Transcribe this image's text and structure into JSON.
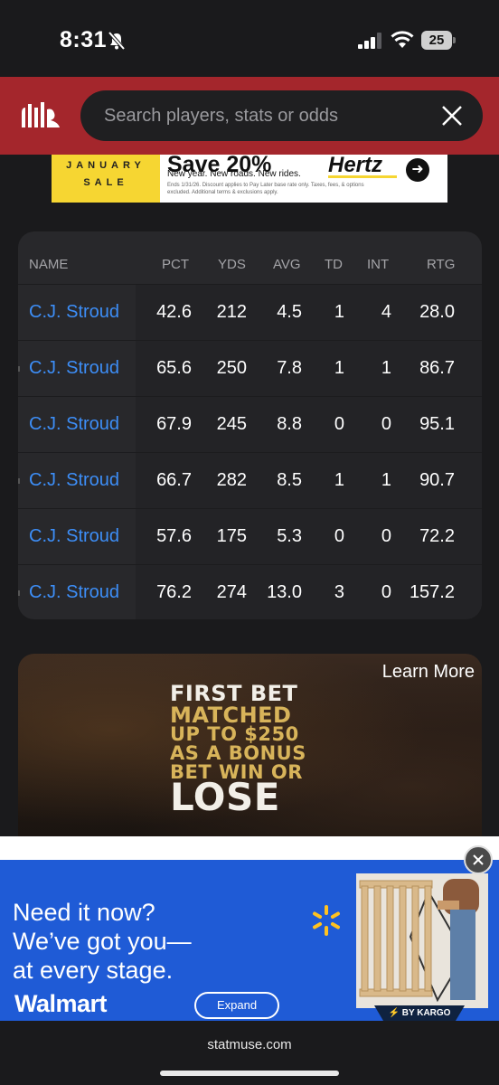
{
  "status_bar": {
    "time": "8:31",
    "battery": "25"
  },
  "header": {
    "search_placeholder": "Search players, stats or odds"
  },
  "top_ad": {
    "month_line1": "JANUARY",
    "month_line2": "SALE",
    "headline": "Save 20%",
    "tagline": "New year. New roads. New rides.",
    "fine_print": "Ends 1/31/26. Discount applies to Pay Later base rate only. Taxes, fees, & options excluded. Additional terms & exclusions apply.",
    "brand": "Hertz"
  },
  "stats_table": {
    "columns": [
      "NAME",
      "PCT",
      "YDS",
      "AVG",
      "TD",
      "INT",
      "RTG"
    ],
    "rows": [
      {
        "name": "C.J. Stroud",
        "pct": "42.6",
        "yds": "212",
        "avg": "4.5",
        "td": "1",
        "int": "4",
        "rtg": "28.0"
      },
      {
        "name": "C.J. Stroud",
        "pct": "65.6",
        "yds": "250",
        "avg": "7.8",
        "td": "1",
        "int": "1",
        "rtg": "86.7"
      },
      {
        "name": "C.J. Stroud",
        "pct": "67.9",
        "yds": "245",
        "avg": "8.8",
        "td": "0",
        "int": "0",
        "rtg": "95.1"
      },
      {
        "name": "C.J. Stroud",
        "pct": "66.7",
        "yds": "282",
        "avg": "8.5",
        "td": "1",
        "int": "1",
        "rtg": "90.7"
      },
      {
        "name": "C.J. Stroud",
        "pct": "57.6",
        "yds": "175",
        "avg": "5.3",
        "td": "0",
        "int": "0",
        "rtg": "72.2"
      },
      {
        "name": "C.J. Stroud",
        "pct": "76.2",
        "yds": "274",
        "avg": "13.0",
        "td": "3",
        "int": "0",
        "rtg": "157.2"
      }
    ]
  },
  "promo": {
    "learn_more": "Learn More",
    "lines": [
      "FIRST BET",
      "MATCHED",
      "UP TO $250",
      "AS A BONUS",
      "BET WIN OR",
      "LOSE"
    ]
  },
  "walmart_ad": {
    "headline_1": "Need it now?",
    "headline_2": "We’ve got you—",
    "headline_3": "at every stage.",
    "brand": "Walmart",
    "expand_label": "Expand",
    "kargo_label": "⚡ BY KARGO"
  },
  "footer": {
    "url": "statmuse.com"
  },
  "colors": {
    "header_red": "#a4262c",
    "link_blue": "#3d8ef7",
    "walmart_blue": "#1f5bd6",
    "walmart_yellow": "#ffc220"
  }
}
